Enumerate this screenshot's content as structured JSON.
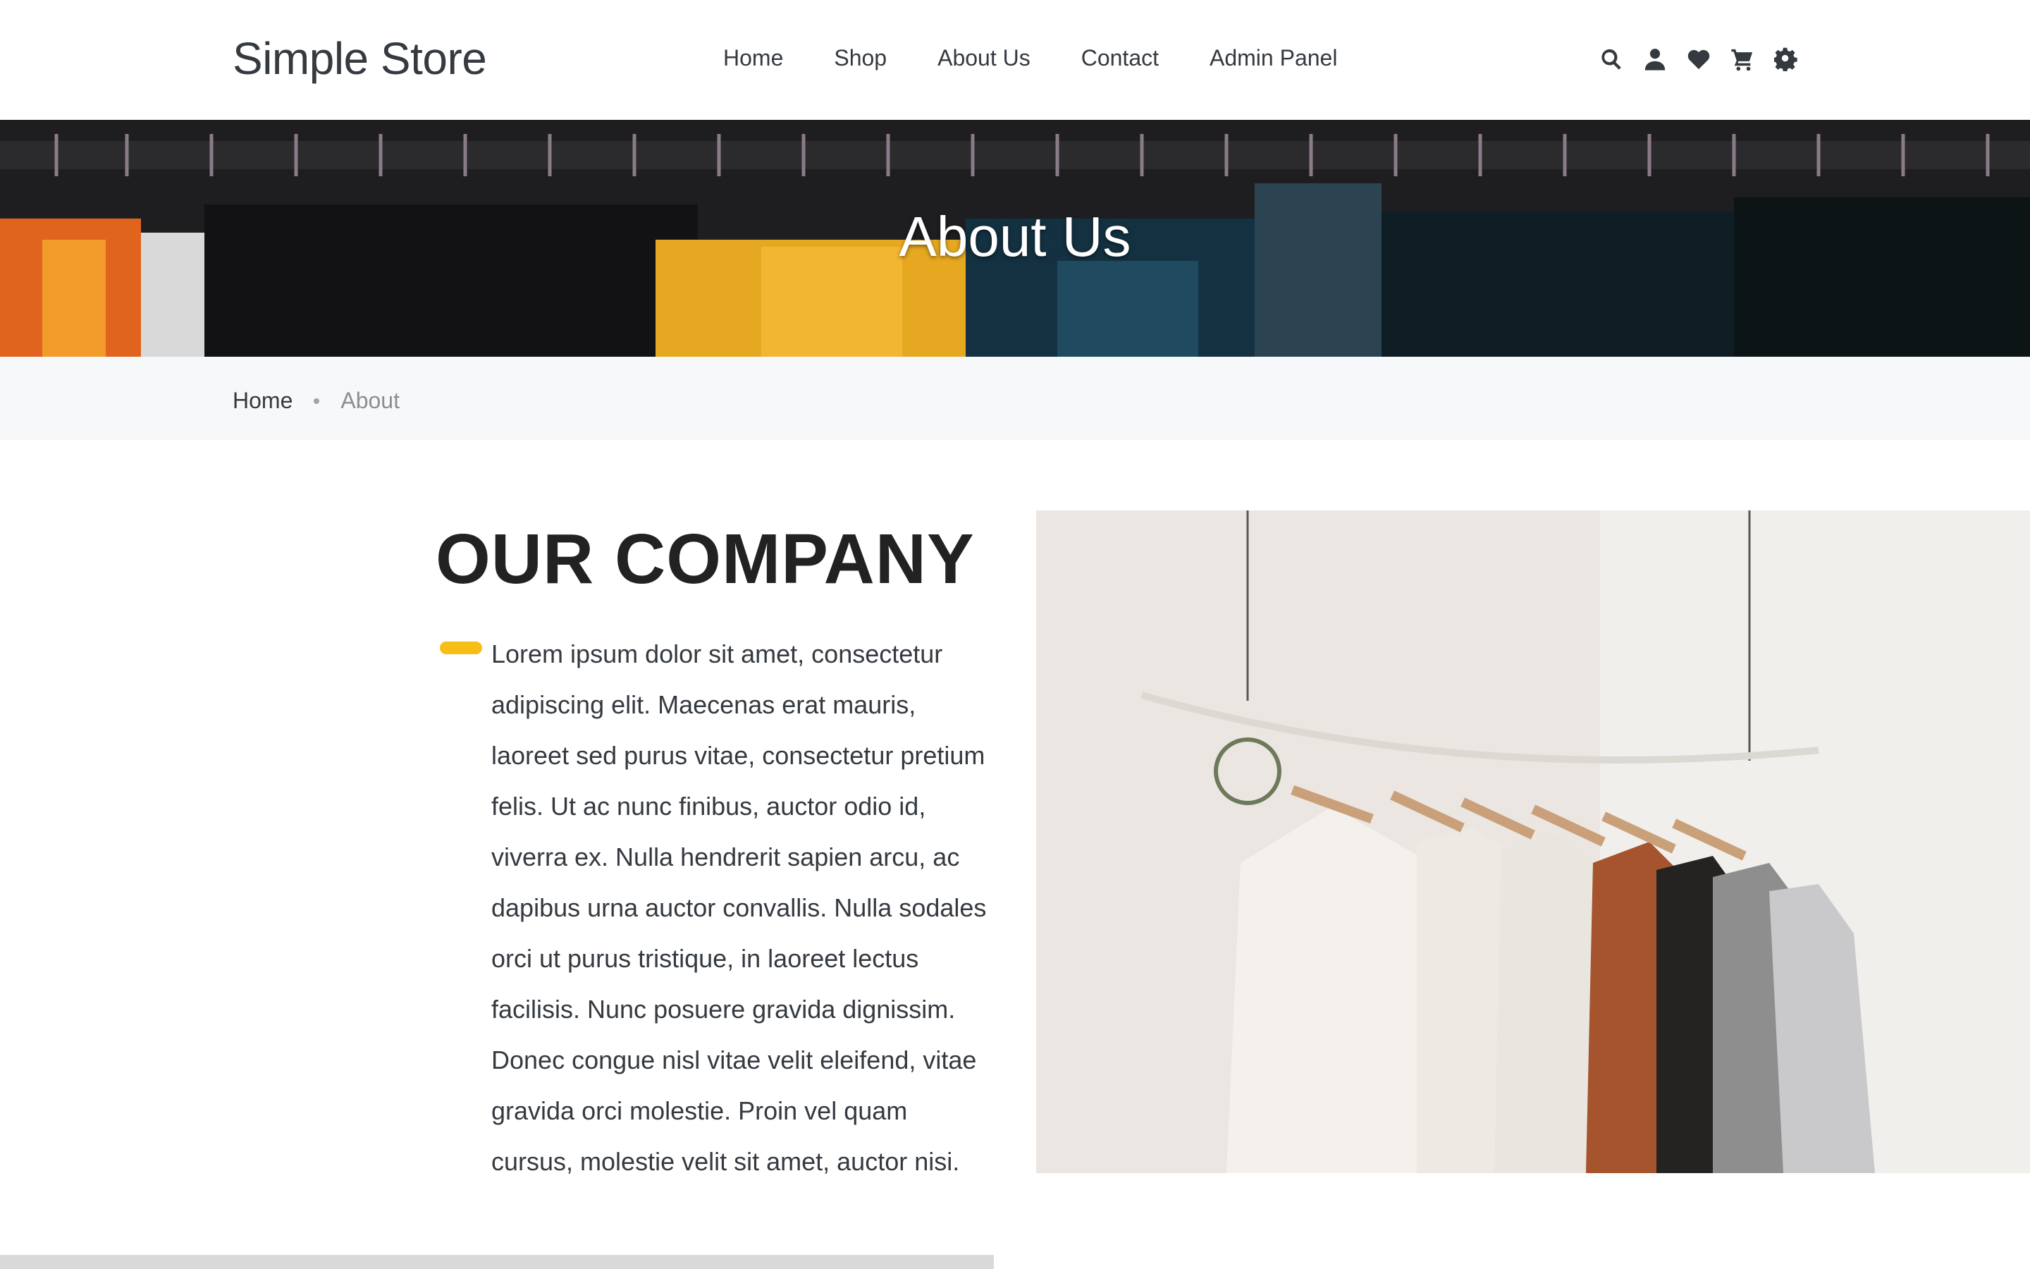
{
  "header": {
    "brand": "Simple Store",
    "nav": [
      {
        "label": "Home"
      },
      {
        "label": "Shop"
      },
      {
        "label": "About Us"
      },
      {
        "label": "Contact"
      },
      {
        "label": "Admin Panel"
      }
    ],
    "icons": [
      "search-icon",
      "user-icon",
      "heart-icon",
      "cart-icon",
      "gear-icon"
    ]
  },
  "hero": {
    "title": "About Us"
  },
  "breadcrumb": {
    "home": "Home",
    "current": "About"
  },
  "company": {
    "heading": "OUR COMPANY",
    "body": "Lorem ipsum dolor sit amet, consectetur adipiscing elit. Maecenas erat mauris, laoreet sed purus vitae, consectetur pretium felis. Ut ac nunc finibus, auctor odio id, viverra ex. Nulla hendrerit sapien arcu, ac dapibus urna auctor convallis. Nulla sodales orci ut purus tristique, in laoreet lectus facilisis. Nunc posuere gravida dignissim. Donec congue nisl vitae velit eleifend, vitae gravida orci molestie. Proin vel quam cursus, molestie velit sit amet, auctor nisi."
  },
  "colors": {
    "accent": "#f7be16",
    "text": "#343a40",
    "breadcrumb_bg": "#f7f8f9"
  }
}
